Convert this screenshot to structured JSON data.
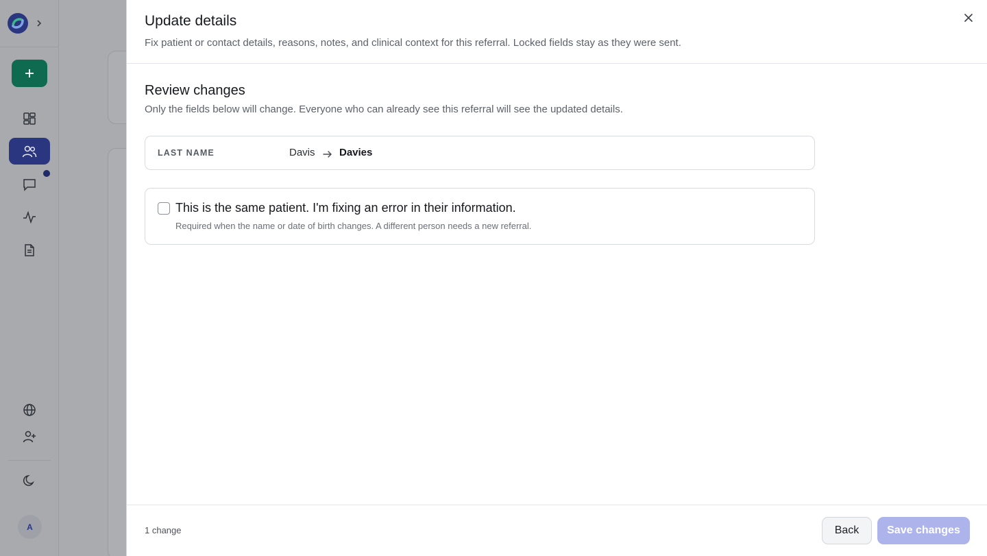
{
  "drawer": {
    "title": "Update details",
    "subtitle": "Fix patient or contact details, reasons, notes, and clinical context for this referral. Locked fields stay as they were sent."
  },
  "review": {
    "title": "Review changes",
    "description": "Only the fields below will change. Everyone who can already see this referral will see the updated details."
  },
  "changes": [
    {
      "field": "LAST NAME",
      "old_value": "Davis",
      "new_value": "Davies"
    }
  ],
  "confirmation": {
    "label": "This is the same patient. I'm fixing an error in their information.",
    "help": "Required when the name or date of birth changes. A different person needs a new referral.",
    "checked": false
  },
  "footer": {
    "change_count": "1 change",
    "back_label": "Back",
    "save_label": "Save changes",
    "save_disabled": true
  },
  "sidebar": {
    "avatar_initial": "A",
    "items": [
      {
        "icon": "dashboard-icon",
        "active": false
      },
      {
        "icon": "patients-icon",
        "active": true
      },
      {
        "icon": "messages-icon",
        "active": false,
        "unread": true
      },
      {
        "icon": "activity-icon",
        "active": false
      },
      {
        "icon": "document-icon",
        "active": false
      }
    ]
  },
  "colors": {
    "brand_primary": "#2b3680",
    "new_button": "#0e6b4f",
    "save_disabled": "#adb4ec"
  }
}
